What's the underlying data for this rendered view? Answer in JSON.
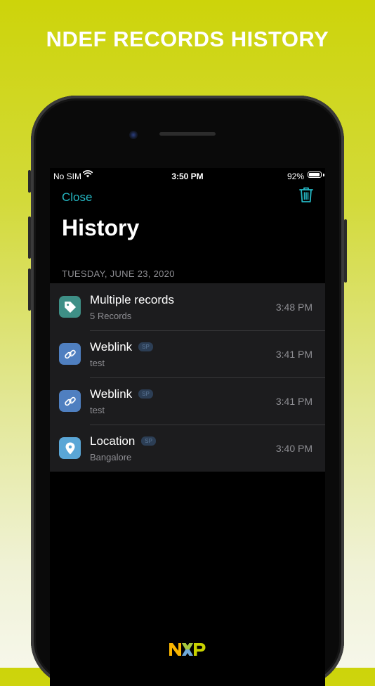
{
  "headline": "NDEF RECORDS HISTORY",
  "status_bar": {
    "carrier": "No SIM",
    "time": "3:50 PM",
    "battery": "92%",
    "battery_level": 0.92
  },
  "nav": {
    "close_label": "Close",
    "trash_icon": "trash-icon"
  },
  "page_title": "History",
  "section": {
    "date_header": "TUESDAY, JUNE 23, 2020",
    "rows": [
      {
        "title": "Multiple records",
        "subtitle": "5 Records",
        "time": "3:48 PM",
        "badge": "",
        "icon": "tag-icon",
        "icon_color": "#3e8f86"
      },
      {
        "title": "Weblink",
        "subtitle": "test",
        "time": "3:41 PM",
        "badge": "SP",
        "icon": "link-icon",
        "icon_color": "#4f7fc0"
      },
      {
        "title": "Weblink",
        "subtitle": "test",
        "time": "3:41 PM",
        "badge": "SP",
        "icon": "link-icon",
        "icon_color": "#4f7fc0"
      },
      {
        "title": "Location",
        "subtitle": "Bangalore",
        "time": "3:40 PM",
        "badge": "SP",
        "icon": "location-pin-icon",
        "icon_color": "#5aa6d6"
      }
    ]
  },
  "colors": {
    "accent": "#25b7c3",
    "background": "#000000",
    "cell": "#1c1c1e",
    "secondary_text": "#8e8e93"
  },
  "logo_text": "NXP"
}
